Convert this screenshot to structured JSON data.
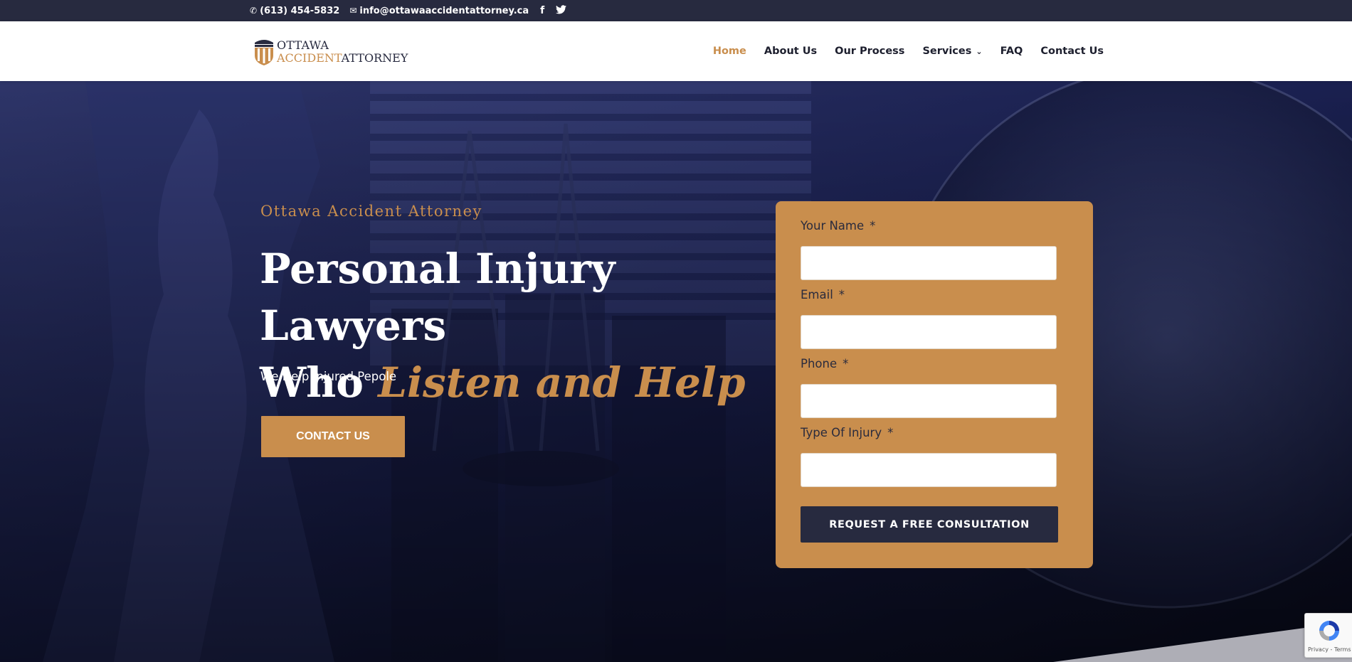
{
  "topbar": {
    "phone": "(613) 454-5832",
    "email": "info@ottawaaccidentattorney.ca",
    "facebook_icon": "facebook-icon",
    "twitter_icon": "twitter-icon"
  },
  "logo": {
    "line1": "OTTAWA",
    "line2a": "ACCIDENT",
    "line2b": "ATTORNEY"
  },
  "nav": {
    "items": [
      {
        "label": "Home"
      },
      {
        "label": "About Us"
      },
      {
        "label": "Our Process"
      },
      {
        "label": "Services"
      },
      {
        "label": "FAQ"
      },
      {
        "label": "Contact Us"
      }
    ]
  },
  "hero": {
    "eyebrow": "Ottawa Accident Attorney",
    "headline_line1": "Personal Injury Lawyers",
    "headline_who": "Who ",
    "headline_accent": "Listen and Help",
    "subtext": "We Help Injured Pepole",
    "cta_label": "CONTACT US"
  },
  "form": {
    "fields": [
      {
        "label": "Your Name",
        "required": "*"
      },
      {
        "label": "Email",
        "required": "*"
      },
      {
        "label": "Phone",
        "required": "*"
      },
      {
        "label": "Type Of Injury",
        "required": "*"
      }
    ],
    "submit_label": "REQUEST A FREE CONSULTATION"
  },
  "recaptcha": {
    "terms": "Privacy - Terms"
  },
  "colors": {
    "accent": "#c98e4d",
    "dark": "#272a3f",
    "hero_tint": "#1b2150"
  }
}
